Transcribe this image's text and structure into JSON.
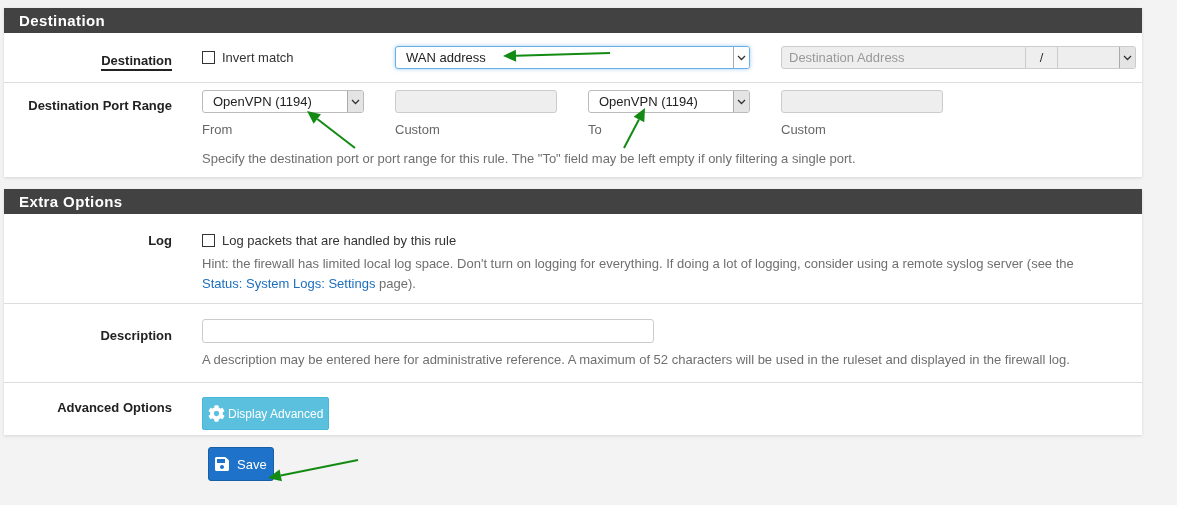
{
  "sections": [
    {
      "title": "Destination",
      "rows": [
        {
          "kind": "destination",
          "label": "Destination",
          "underlined": true,
          "invert": {
            "label": "Invert match",
            "checked": false
          },
          "type_select": {
            "value": "WAN address",
            "focused": true
          },
          "address": {
            "placeholder": "Destination Address",
            "separator": "/",
            "disabled": true
          }
        },
        {
          "kind": "port_range",
          "label": "Destination Port Range",
          "underlined": false,
          "fields": [
            {
              "kind": "select",
              "value": "OpenVPN (1194)",
              "caption": "From"
            },
            {
              "kind": "input",
              "disabled": true,
              "caption": "Custom"
            },
            {
              "kind": "select",
              "value": "OpenVPN (1194)",
              "caption": "To"
            },
            {
              "kind": "input",
              "disabled": true,
              "caption": "Custom"
            }
          ],
          "help": "Specify the destination port or port range for this rule. The \"To\" field may be left empty if only filtering a single port."
        }
      ]
    },
    {
      "title": "Extra Options",
      "rows": [
        {
          "kind": "checkbox",
          "label": "Log",
          "underlined": false,
          "checkbox": {
            "label": "Log packets that are handled by this rule",
            "checked": false
          },
          "help_before": "Hint: the firewall has limited local log space. Don't turn on logging for everything. If doing a lot of logging, consider using a remote syslog server (see the ",
          "help_link": "Status: System Logs: Settings",
          "help_after": " page)."
        },
        {
          "kind": "text",
          "label": "Description",
          "underlined": false,
          "help": "A description may be entered here for administrative reference. A maximum of 52 characters will be used in the ruleset and displayed in the firewall log."
        },
        {
          "kind": "button",
          "label": "Advanced Options",
          "underlined": false,
          "button": {
            "label": "Display Advanced"
          }
        }
      ]
    }
  ],
  "save_button": {
    "label": "Save"
  }
}
